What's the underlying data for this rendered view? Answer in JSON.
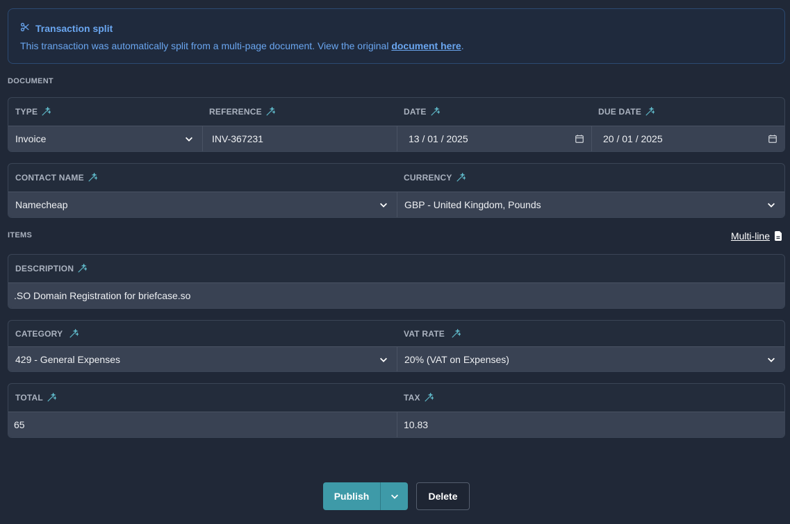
{
  "banner": {
    "title": "Transaction split",
    "text_before": "This transaction was automatically split from a multi-page document. View the original ",
    "link": "document here",
    "text_after": "."
  },
  "document": {
    "section_label": "DOCUMENT",
    "type_label": "TYPE",
    "type_value": "Invoice",
    "reference_label": "REFERENCE",
    "reference_value": "INV-367231",
    "date_label": "DATE",
    "date_value": "13 / 01 / 2025",
    "due_date_label": "DUE DATE",
    "due_date_value": "20 / 01 / 2025",
    "contact_label": "CONTACT NAME",
    "contact_value": "Namecheap",
    "currency_label": "CURRENCY",
    "currency_value": "GBP - United Kingdom, Pounds"
  },
  "items": {
    "section_label": "ITEMS",
    "multiline_label": "Multi-line",
    "description_label": "DESCRIPTION",
    "description_value": ".SO Domain Registration for briefcase.so",
    "category_label": "CATEGORY",
    "category_value": "429 - General Expenses",
    "vat_label": "VAT RATE",
    "vat_value": "20% (VAT on Expenses)",
    "total_label": "TOTAL",
    "total_value": "65",
    "tax_label": "TAX",
    "tax_value": "10.83"
  },
  "actions": {
    "publish": "Publish",
    "delete": "Delete"
  },
  "colors": {
    "background": "#202837",
    "accent": "#3e9aa8",
    "banner_text": "#6aa6f0",
    "wand": "#5fb8c8"
  },
  "icons": [
    "scissors-icon",
    "magic-wand-icon",
    "chevron-down-icon",
    "calendar-icon",
    "document-icon"
  ]
}
